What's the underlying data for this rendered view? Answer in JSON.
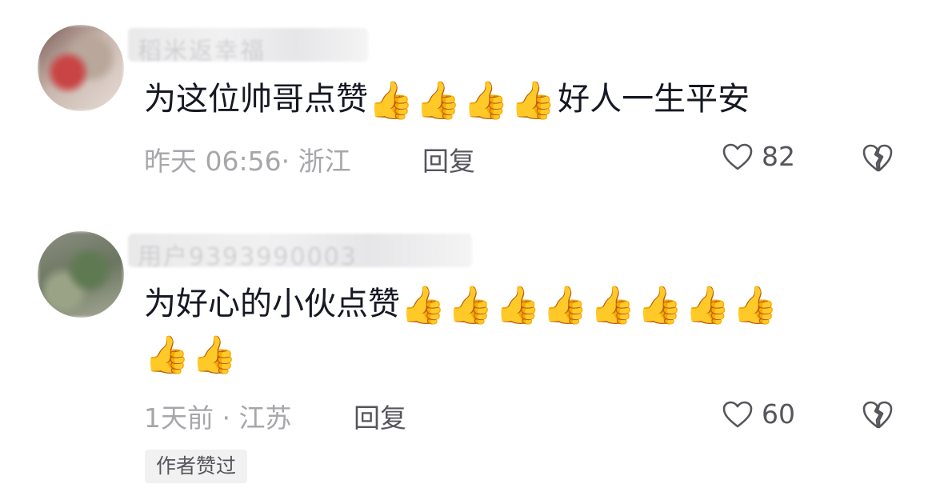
{
  "comments": [
    {
      "username": "稻米返幸福",
      "text": "为这位帅哥点赞",
      "thumbs": [
        "👍",
        "👍",
        "👍",
        "👍"
      ],
      "text_after": "好人一生平安",
      "time": "昨天 06:56",
      "location": "浙江",
      "meta": "昨天 06:56· 浙江",
      "reply_label": "回复",
      "likes": "82",
      "like_icon": "heart-outline-icon",
      "dislike_icon": "broken-heart-icon"
    },
    {
      "username": "用户9393990003",
      "text": "为好心的小伙点赞",
      "thumbs": [
        "👍",
        "👍",
        "👍",
        "👍",
        "👍",
        "👍",
        "👍",
        "👍"
      ],
      "thumbs_line2": [
        "👍",
        "👍"
      ],
      "time": "1天前",
      "location": "江苏",
      "meta": "1天前 · 江苏",
      "reply_label": "回复",
      "likes": "60",
      "like_icon": "heart-outline-icon",
      "dislike_icon": "broken-heart-icon",
      "badge": "作者赞过"
    }
  ],
  "colors": {
    "text": "#161823",
    "meta": "#a7a7ab",
    "action": "#55555c",
    "badge_bg": "#f1f1f2"
  }
}
